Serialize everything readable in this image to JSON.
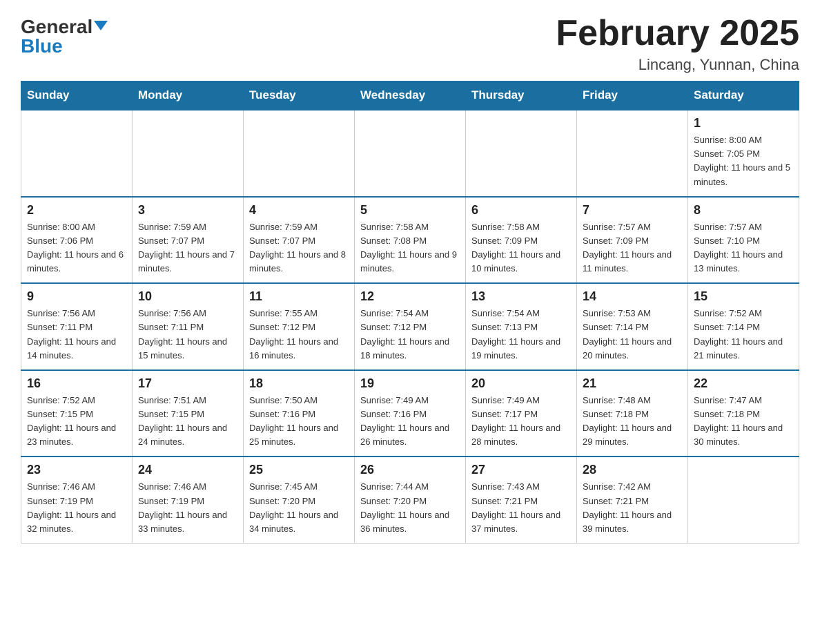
{
  "header": {
    "logo": {
      "general": "General",
      "blue": "Blue",
      "arrow": "▼"
    },
    "title": "February 2025",
    "location": "Lincang, Yunnan, China"
  },
  "days_of_week": [
    "Sunday",
    "Monday",
    "Tuesday",
    "Wednesday",
    "Thursday",
    "Friday",
    "Saturday"
  ],
  "weeks": [
    [
      {
        "day": "",
        "info": ""
      },
      {
        "day": "",
        "info": ""
      },
      {
        "day": "",
        "info": ""
      },
      {
        "day": "",
        "info": ""
      },
      {
        "day": "",
        "info": ""
      },
      {
        "day": "",
        "info": ""
      },
      {
        "day": "1",
        "info": "Sunrise: 8:00 AM\nSunset: 7:05 PM\nDaylight: 11 hours and 5 minutes."
      }
    ],
    [
      {
        "day": "2",
        "info": "Sunrise: 8:00 AM\nSunset: 7:06 PM\nDaylight: 11 hours and 6 minutes."
      },
      {
        "day": "3",
        "info": "Sunrise: 7:59 AM\nSunset: 7:07 PM\nDaylight: 11 hours and 7 minutes."
      },
      {
        "day": "4",
        "info": "Sunrise: 7:59 AM\nSunset: 7:07 PM\nDaylight: 11 hours and 8 minutes."
      },
      {
        "day": "5",
        "info": "Sunrise: 7:58 AM\nSunset: 7:08 PM\nDaylight: 11 hours and 9 minutes."
      },
      {
        "day": "6",
        "info": "Sunrise: 7:58 AM\nSunset: 7:09 PM\nDaylight: 11 hours and 10 minutes."
      },
      {
        "day": "7",
        "info": "Sunrise: 7:57 AM\nSunset: 7:09 PM\nDaylight: 11 hours and 11 minutes."
      },
      {
        "day": "8",
        "info": "Sunrise: 7:57 AM\nSunset: 7:10 PM\nDaylight: 11 hours and 13 minutes."
      }
    ],
    [
      {
        "day": "9",
        "info": "Sunrise: 7:56 AM\nSunset: 7:11 PM\nDaylight: 11 hours and 14 minutes."
      },
      {
        "day": "10",
        "info": "Sunrise: 7:56 AM\nSunset: 7:11 PM\nDaylight: 11 hours and 15 minutes."
      },
      {
        "day": "11",
        "info": "Sunrise: 7:55 AM\nSunset: 7:12 PM\nDaylight: 11 hours and 16 minutes."
      },
      {
        "day": "12",
        "info": "Sunrise: 7:54 AM\nSunset: 7:12 PM\nDaylight: 11 hours and 18 minutes."
      },
      {
        "day": "13",
        "info": "Sunrise: 7:54 AM\nSunset: 7:13 PM\nDaylight: 11 hours and 19 minutes."
      },
      {
        "day": "14",
        "info": "Sunrise: 7:53 AM\nSunset: 7:14 PM\nDaylight: 11 hours and 20 minutes."
      },
      {
        "day": "15",
        "info": "Sunrise: 7:52 AM\nSunset: 7:14 PM\nDaylight: 11 hours and 21 minutes."
      }
    ],
    [
      {
        "day": "16",
        "info": "Sunrise: 7:52 AM\nSunset: 7:15 PM\nDaylight: 11 hours and 23 minutes."
      },
      {
        "day": "17",
        "info": "Sunrise: 7:51 AM\nSunset: 7:15 PM\nDaylight: 11 hours and 24 minutes."
      },
      {
        "day": "18",
        "info": "Sunrise: 7:50 AM\nSunset: 7:16 PM\nDaylight: 11 hours and 25 minutes."
      },
      {
        "day": "19",
        "info": "Sunrise: 7:49 AM\nSunset: 7:16 PM\nDaylight: 11 hours and 26 minutes."
      },
      {
        "day": "20",
        "info": "Sunrise: 7:49 AM\nSunset: 7:17 PM\nDaylight: 11 hours and 28 minutes."
      },
      {
        "day": "21",
        "info": "Sunrise: 7:48 AM\nSunset: 7:18 PM\nDaylight: 11 hours and 29 minutes."
      },
      {
        "day": "22",
        "info": "Sunrise: 7:47 AM\nSunset: 7:18 PM\nDaylight: 11 hours and 30 minutes."
      }
    ],
    [
      {
        "day": "23",
        "info": "Sunrise: 7:46 AM\nSunset: 7:19 PM\nDaylight: 11 hours and 32 minutes."
      },
      {
        "day": "24",
        "info": "Sunrise: 7:46 AM\nSunset: 7:19 PM\nDaylight: 11 hours and 33 minutes."
      },
      {
        "day": "25",
        "info": "Sunrise: 7:45 AM\nSunset: 7:20 PM\nDaylight: 11 hours and 34 minutes."
      },
      {
        "day": "26",
        "info": "Sunrise: 7:44 AM\nSunset: 7:20 PM\nDaylight: 11 hours and 36 minutes."
      },
      {
        "day": "27",
        "info": "Sunrise: 7:43 AM\nSunset: 7:21 PM\nDaylight: 11 hours and 37 minutes."
      },
      {
        "day": "28",
        "info": "Sunrise: 7:42 AM\nSunset: 7:21 PM\nDaylight: 11 hours and 39 minutes."
      },
      {
        "day": "",
        "info": ""
      }
    ]
  ]
}
